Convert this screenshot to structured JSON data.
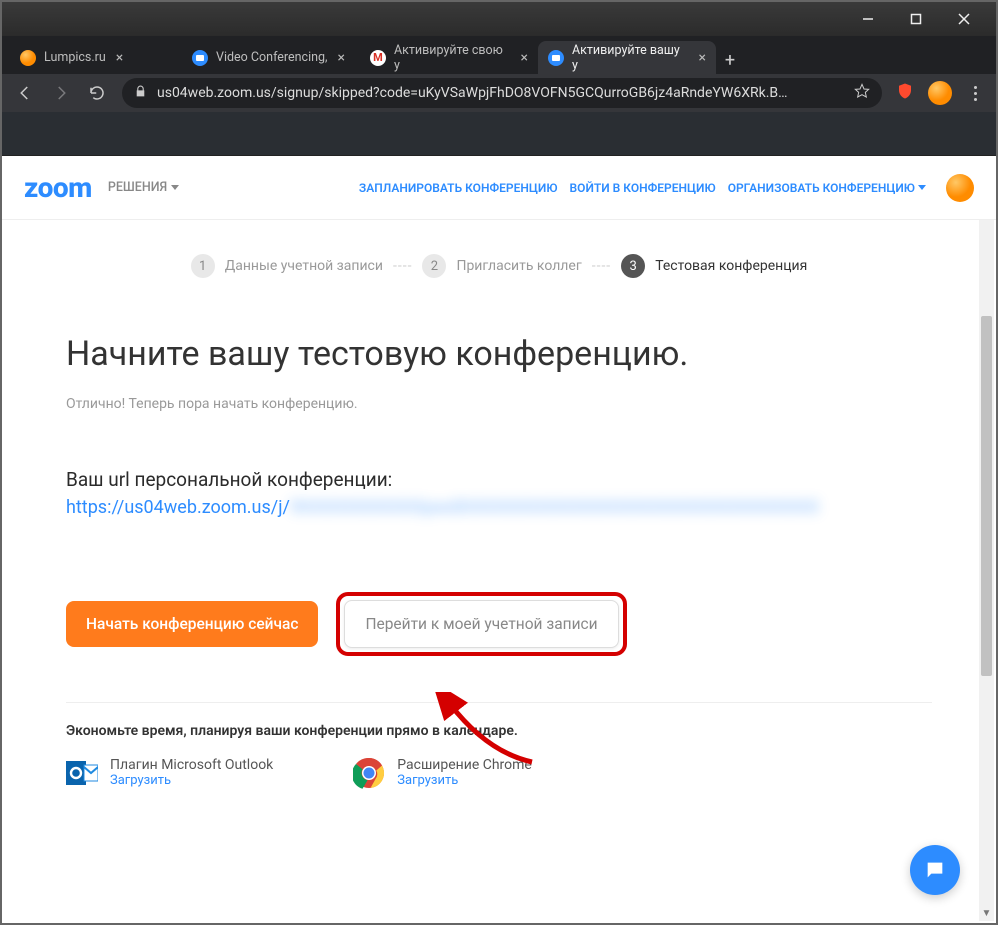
{
  "tabs": [
    {
      "title": "Lumpics.ru",
      "icon": "orange"
    },
    {
      "title": "Video Conferencing,",
      "icon": "zoom"
    },
    {
      "title": "Активируйте свою у",
      "icon": "gmail"
    },
    {
      "title": "Активируйте вашу у",
      "icon": "zoom",
      "active": true
    }
  ],
  "url": "us04web.zoom.us/signup/skipped?code=uKyVSaWpjFhDO8VOFN5GCQurroGB6jz4aRndeYW6XRk.B…",
  "logo": "zoom",
  "solutions": "РЕШЕНИЯ",
  "navlinks": {
    "plan": "ЗАПЛАНИРОВАТЬ КОНФЕРЕНЦИЮ",
    "join": "ВОЙТИ В КОНФЕРЕНЦИЮ",
    "host": "ОРГАНИЗОВАТЬ КОНФЕРЕНЦИЮ"
  },
  "steps": {
    "s1": "Данные учетной записи",
    "s2": "Пригласить коллег",
    "s3": "Тестовая конференция"
  },
  "heading": "Начните вашу тестовую конференцию.",
  "subtitle": "Отлично! Теперь пора начать конференцию.",
  "url_label": "Ваш url персональной конференции:",
  "personal_url_prefix": "https://us04web.zoom.us/j/",
  "btn_primary": "Начать конференцию сейчас",
  "btn_secondary": "Перейти к моей учетной записи",
  "save_time": "Экономьте время, планируя ваши конференции прямо в календаре.",
  "plugins": {
    "outlook": {
      "title": "Плагин Microsoft Outlook",
      "download": "Загрузить"
    },
    "chrome": {
      "title": "Расширение Chrome",
      "download": "Загрузить"
    }
  }
}
